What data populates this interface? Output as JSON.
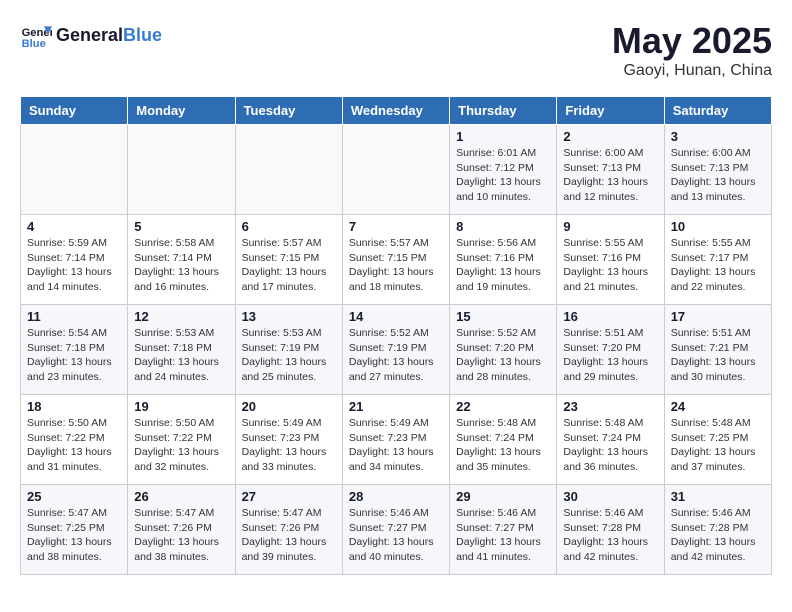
{
  "logo": {
    "text_general": "General",
    "text_blue": "Blue"
  },
  "title": "May 2025",
  "subtitle": "Gaoyi, Hunan, China",
  "days_of_week": [
    "Sunday",
    "Monday",
    "Tuesday",
    "Wednesday",
    "Thursday",
    "Friday",
    "Saturday"
  ],
  "weeks": [
    [
      {
        "day": "",
        "info": ""
      },
      {
        "day": "",
        "info": ""
      },
      {
        "day": "",
        "info": ""
      },
      {
        "day": "",
        "info": ""
      },
      {
        "day": "1",
        "info": "Sunrise: 6:01 AM\nSunset: 7:12 PM\nDaylight: 13 hours\nand 10 minutes."
      },
      {
        "day": "2",
        "info": "Sunrise: 6:00 AM\nSunset: 7:13 PM\nDaylight: 13 hours\nand 12 minutes."
      },
      {
        "day": "3",
        "info": "Sunrise: 6:00 AM\nSunset: 7:13 PM\nDaylight: 13 hours\nand 13 minutes."
      }
    ],
    [
      {
        "day": "4",
        "info": "Sunrise: 5:59 AM\nSunset: 7:14 PM\nDaylight: 13 hours\nand 14 minutes."
      },
      {
        "day": "5",
        "info": "Sunrise: 5:58 AM\nSunset: 7:14 PM\nDaylight: 13 hours\nand 16 minutes."
      },
      {
        "day": "6",
        "info": "Sunrise: 5:57 AM\nSunset: 7:15 PM\nDaylight: 13 hours\nand 17 minutes."
      },
      {
        "day": "7",
        "info": "Sunrise: 5:57 AM\nSunset: 7:15 PM\nDaylight: 13 hours\nand 18 minutes."
      },
      {
        "day": "8",
        "info": "Sunrise: 5:56 AM\nSunset: 7:16 PM\nDaylight: 13 hours\nand 19 minutes."
      },
      {
        "day": "9",
        "info": "Sunrise: 5:55 AM\nSunset: 7:16 PM\nDaylight: 13 hours\nand 21 minutes."
      },
      {
        "day": "10",
        "info": "Sunrise: 5:55 AM\nSunset: 7:17 PM\nDaylight: 13 hours\nand 22 minutes."
      }
    ],
    [
      {
        "day": "11",
        "info": "Sunrise: 5:54 AM\nSunset: 7:18 PM\nDaylight: 13 hours\nand 23 minutes."
      },
      {
        "day": "12",
        "info": "Sunrise: 5:53 AM\nSunset: 7:18 PM\nDaylight: 13 hours\nand 24 minutes."
      },
      {
        "day": "13",
        "info": "Sunrise: 5:53 AM\nSunset: 7:19 PM\nDaylight: 13 hours\nand 25 minutes."
      },
      {
        "day": "14",
        "info": "Sunrise: 5:52 AM\nSunset: 7:19 PM\nDaylight: 13 hours\nand 27 minutes."
      },
      {
        "day": "15",
        "info": "Sunrise: 5:52 AM\nSunset: 7:20 PM\nDaylight: 13 hours\nand 28 minutes."
      },
      {
        "day": "16",
        "info": "Sunrise: 5:51 AM\nSunset: 7:20 PM\nDaylight: 13 hours\nand 29 minutes."
      },
      {
        "day": "17",
        "info": "Sunrise: 5:51 AM\nSunset: 7:21 PM\nDaylight: 13 hours\nand 30 minutes."
      }
    ],
    [
      {
        "day": "18",
        "info": "Sunrise: 5:50 AM\nSunset: 7:22 PM\nDaylight: 13 hours\nand 31 minutes."
      },
      {
        "day": "19",
        "info": "Sunrise: 5:50 AM\nSunset: 7:22 PM\nDaylight: 13 hours\nand 32 minutes."
      },
      {
        "day": "20",
        "info": "Sunrise: 5:49 AM\nSunset: 7:23 PM\nDaylight: 13 hours\nand 33 minutes."
      },
      {
        "day": "21",
        "info": "Sunrise: 5:49 AM\nSunset: 7:23 PM\nDaylight: 13 hours\nand 34 minutes."
      },
      {
        "day": "22",
        "info": "Sunrise: 5:48 AM\nSunset: 7:24 PM\nDaylight: 13 hours\nand 35 minutes."
      },
      {
        "day": "23",
        "info": "Sunrise: 5:48 AM\nSunset: 7:24 PM\nDaylight: 13 hours\nand 36 minutes."
      },
      {
        "day": "24",
        "info": "Sunrise: 5:48 AM\nSunset: 7:25 PM\nDaylight: 13 hours\nand 37 minutes."
      }
    ],
    [
      {
        "day": "25",
        "info": "Sunrise: 5:47 AM\nSunset: 7:25 PM\nDaylight: 13 hours\nand 38 minutes."
      },
      {
        "day": "26",
        "info": "Sunrise: 5:47 AM\nSunset: 7:26 PM\nDaylight: 13 hours\nand 38 minutes."
      },
      {
        "day": "27",
        "info": "Sunrise: 5:47 AM\nSunset: 7:26 PM\nDaylight: 13 hours\nand 39 minutes."
      },
      {
        "day": "28",
        "info": "Sunrise: 5:46 AM\nSunset: 7:27 PM\nDaylight: 13 hours\nand 40 minutes."
      },
      {
        "day": "29",
        "info": "Sunrise: 5:46 AM\nSunset: 7:27 PM\nDaylight: 13 hours\nand 41 minutes."
      },
      {
        "day": "30",
        "info": "Sunrise: 5:46 AM\nSunset: 7:28 PM\nDaylight: 13 hours\nand 42 minutes."
      },
      {
        "day": "31",
        "info": "Sunrise: 5:46 AM\nSunset: 7:28 PM\nDaylight: 13 hours\nand 42 minutes."
      }
    ]
  ]
}
